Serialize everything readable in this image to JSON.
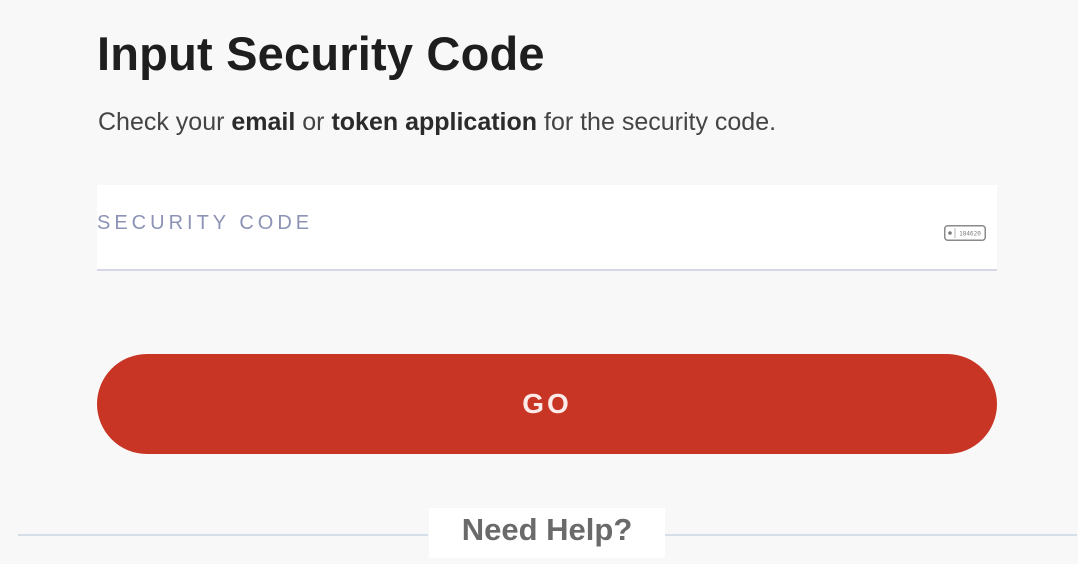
{
  "heading": {
    "title": "Input Security Code",
    "subtitle_prefix": "Check your ",
    "subtitle_bold_1": "email",
    "subtitle_mid": " or ",
    "subtitle_bold_2": "token application",
    "subtitle_suffix": " for the security code."
  },
  "security_code": {
    "label": "SECURITY CODE",
    "value": "",
    "icon": "token-device-icon",
    "icon_text": "184620"
  },
  "submit": {
    "label": "GO"
  },
  "help": {
    "label": "Need Help?"
  },
  "colors": {
    "accent": "#c83524",
    "label": "#8c93b6",
    "divider": "#d6dee8"
  }
}
